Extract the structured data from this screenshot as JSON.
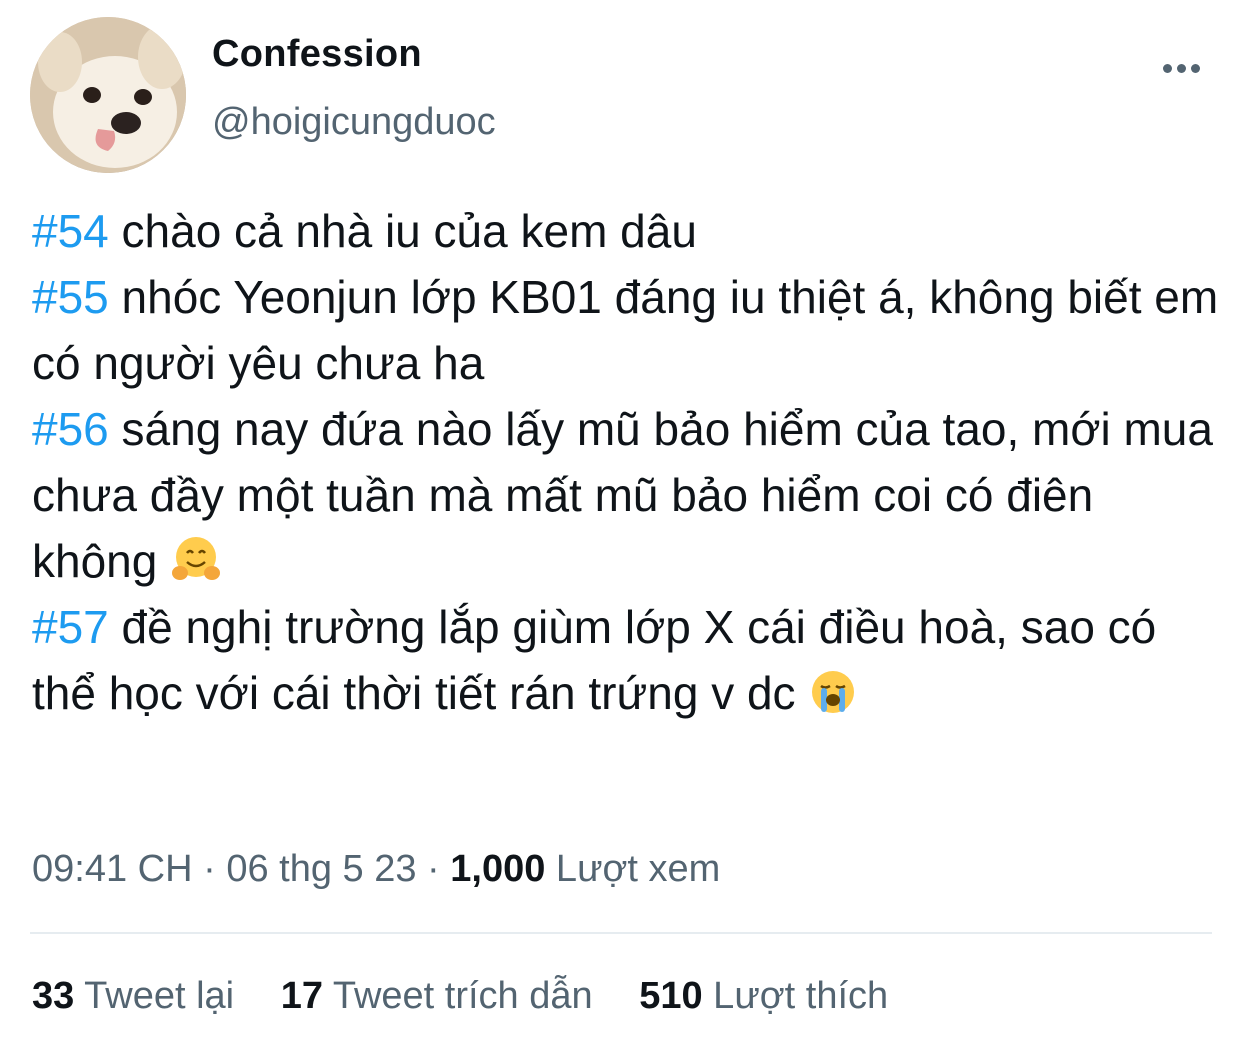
{
  "author": {
    "display_name": "Confession",
    "handle": "@hoigicungduoc"
  },
  "tweet": {
    "entries": [
      {
        "tag": "#54",
        "text": " chào cả nhà iu của kem dâu"
      },
      {
        "tag": "#55",
        "text": " nhóc Yeonjun lớp KB01 đáng iu thiệt á, không biết em có người yêu chưa ha"
      },
      {
        "tag": "#56",
        "text": " sáng nay đứa nào lấy mũ bảo hiểm của tao, mới mua chưa đầy một tuần mà mất mũ bảo hiểm coi có điên không",
        "emoji": "smiling-face-with-open-hands"
      },
      {
        "tag": "#57",
        "text": " đề nghị trường lắp giùm lớp X cái điều hoà, sao có thể học với cái thời tiết rán trứng v dc",
        "emoji": "loudly-crying-face"
      }
    ]
  },
  "meta": {
    "time": "09:41 CH",
    "sep1": " · ",
    "date": "06 thg 5 23",
    "sep2": " · ",
    "views_count": "1,000",
    "views_label": " Lượt xem"
  },
  "stats": {
    "retweets_count": "33",
    "retweets_label": " Tweet lại",
    "quotes_count": "17",
    "quotes_label": " Tweet trích dẫn",
    "likes_count": "510",
    "likes_label": " Lượt thích"
  },
  "colors": {
    "hashtag": "#1d9bf0",
    "secondary_text": "#536471",
    "primary_text": "#0f1419",
    "divider": "#e6ecf0"
  }
}
